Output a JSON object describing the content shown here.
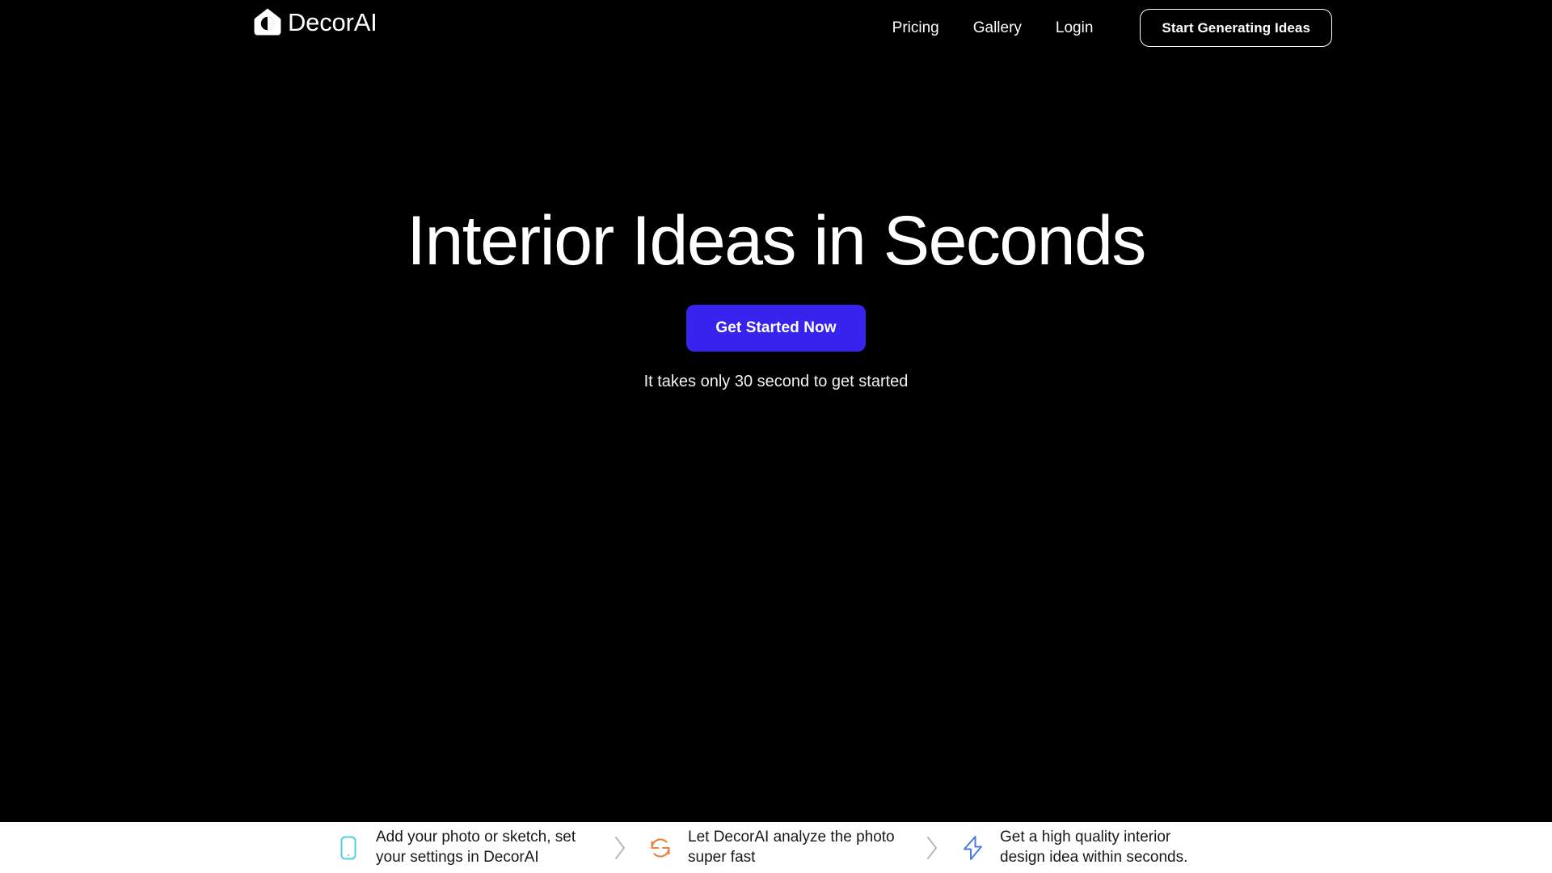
{
  "theme": {
    "background": "#000000",
    "accent_blue": "#3722EE",
    "bar_background": "#ffffff",
    "text_on_dark": "#ffffff",
    "text_on_light": "#18181b",
    "step_icon_cyan": "#4FCDE4",
    "step_icon_orange": "#E8823C",
    "step_icon_blue": "#4A7BE0",
    "separator_gray": "#b8b8b8"
  },
  "header": {
    "brand": {
      "name": "DecorAI",
      "logo_icon": "house-camera-logo-icon"
    },
    "nav": [
      {
        "label": "Pricing"
      },
      {
        "label": "Gallery"
      },
      {
        "label": "Login"
      }
    ],
    "cta": {
      "label": "Start Generating Ideas"
    }
  },
  "hero": {
    "title": "Interior Ideas in Seconds",
    "cta_label": "Get Started Now",
    "note": "It takes only 30 second to get started"
  },
  "steps_bar": {
    "separator_icon": "chevron-right-icon",
    "steps": [
      {
        "icon": "phone-device-icon",
        "text": "Add your photo or sketch, set your settings in DecorAI"
      },
      {
        "icon": "refresh-sync-icon",
        "text": "Let DecorAI analyze the photo super fast"
      },
      {
        "icon": "lightning-bolt-icon",
        "text": "Get a high quality interior design idea within seconds."
      }
    ]
  }
}
